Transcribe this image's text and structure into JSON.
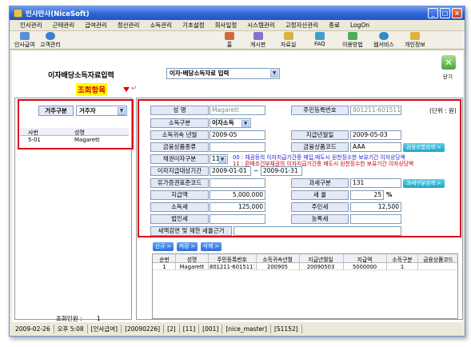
{
  "window": {
    "title": "인사만사(NiceSoft)"
  },
  "menu": [
    "인사관리",
    "근태관리",
    "급여관리",
    "정산관리",
    "소득관리",
    "기초설정",
    "회사일정",
    "시스템관리",
    "고정자산관리",
    "종료",
    "LogOn"
  ],
  "toolbar": {
    "items": [
      {
        "label": "인사급여",
        "icon": "calculator-icon"
      },
      {
        "label": "고객관리",
        "icon": "customer-icon"
      },
      {
        "label": "홈",
        "icon": "home-icon"
      },
      {
        "label": "게시판",
        "icon": "board-icon"
      },
      {
        "label": "자료실",
        "icon": "archive-icon"
      },
      {
        "label": "FAQ",
        "icon": "faq-icon"
      },
      {
        "label": "이용방법",
        "icon": "help-icon"
      },
      {
        "label": "웹서비스",
        "icon": "web-icon"
      },
      {
        "label": "개인정보",
        "icon": "key-icon"
      }
    ]
  },
  "page": {
    "title": "이자배당소득자료입력",
    "form_select": "이자·배당소득자료 입력",
    "close_label": "닫기"
  },
  "annotation": {
    "label": "조회항목",
    "return_mark": "↵"
  },
  "left": {
    "filter_label": "거주구분",
    "filter_value": "거주자",
    "columns": [
      "사번",
      "성명"
    ],
    "rows": [
      {
        "id": "5-01",
        "name": "Magarett"
      }
    ],
    "footer_label": "조회인원 :",
    "footer_count": "1"
  },
  "form": {
    "unit": "(단위 : 원)",
    "name_label": "성 명",
    "name_value": "Magarett",
    "rrn_label": "주민등록번호",
    "rrn_value": "801211-6015111",
    "income_type_label": "소득구분",
    "income_type_value": "이자소득",
    "attrib_month_label": "소득귀속 년월",
    "attrib_month_value": "2009-05",
    "pay_date_label": "지급년월일",
    "pay_date_value": "2009-05-03",
    "product_type_label": "금융상품종류",
    "product_type_value": "",
    "product_code_label": "금융상품코드",
    "product_code_value": "AAA",
    "product_search_btn": "금융상품검색 >",
    "bond_type_label": "채권이자구분",
    "bond_type_value": "11",
    "note_00": "00 : 채권등의 이자지급기간중 매입,매도시 원천징수한 보유기간 이자상당액",
    "note_11": "11 : 환매조건부채권의 이자지급기간중 매도시 원천징수한 보유기간 이자상당액",
    "interest_period_label": "이자지급대상기간",
    "period_from": "2009-01-01",
    "period_sep": "~",
    "period_to": "2009-01-31",
    "securities_code_label": "유가증권표준코드",
    "securities_code_value": "",
    "tax_type_label": "과세구분",
    "tax_type_value": "131",
    "tax_search_btn": "과세구분검색 >",
    "payment_label": "지급액",
    "payment_value": "5,000,000",
    "tax_rate_label": "세 율",
    "tax_rate_value": "25",
    "tax_rate_unit": "%",
    "income_tax_label": "소득세",
    "income_tax_value": "125,000",
    "resident_tax_label": "주민세",
    "resident_tax_value": "12,500",
    "corp_tax_label": "법인세",
    "corp_tax_value": "",
    "rural_tax_label": "농특세",
    "rural_tax_value": "",
    "reduction_label": "세액감면 및 제한 세율근거",
    "reduction_value": ""
  },
  "actions": {
    "new": "신규 >",
    "save": "저장 >",
    "delete": "삭제 >"
  },
  "table": {
    "columns": [
      "순번",
      "성명",
      "주민등록번호",
      "소득귀속년월",
      "지급년월일",
      "지급액",
      "소득구분",
      "금융상품코드"
    ],
    "rows": [
      [
        "1",
        "Magarett",
        "801211-6015111",
        "200905",
        "20090503",
        "5000000",
        "1",
        ""
      ]
    ]
  },
  "status": [
    "2009-02-26",
    "오후 5:08",
    "[인사급여]",
    "[20090226]",
    "[2]",
    "[11]",
    "[001]",
    "[nice_master]",
    "[S1152]"
  ]
}
